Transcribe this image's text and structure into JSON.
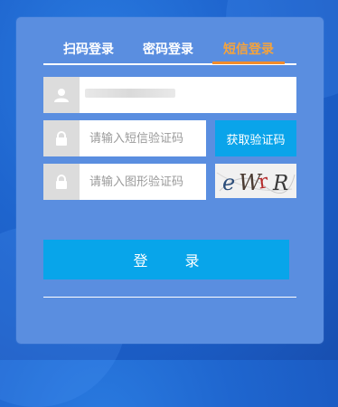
{
  "tabs": [
    {
      "label": "扫码登录",
      "active": false
    },
    {
      "label": "密码登录",
      "active": false
    },
    {
      "label": "短信登录",
      "active": true
    }
  ],
  "phone": {
    "icon": "user-icon"
  },
  "sms_code": {
    "icon": "lock-icon",
    "placeholder": "请输入短信验证码",
    "button_label": "获取验证码"
  },
  "image_code": {
    "icon": "lock-icon",
    "placeholder": "请输入图形验证码",
    "captcha_text": "eWrR"
  },
  "login_button": "登 录",
  "colors": {
    "active_tab": "#f6a33a",
    "button": "#0aa4ea",
    "card": "#5a8ee0"
  }
}
